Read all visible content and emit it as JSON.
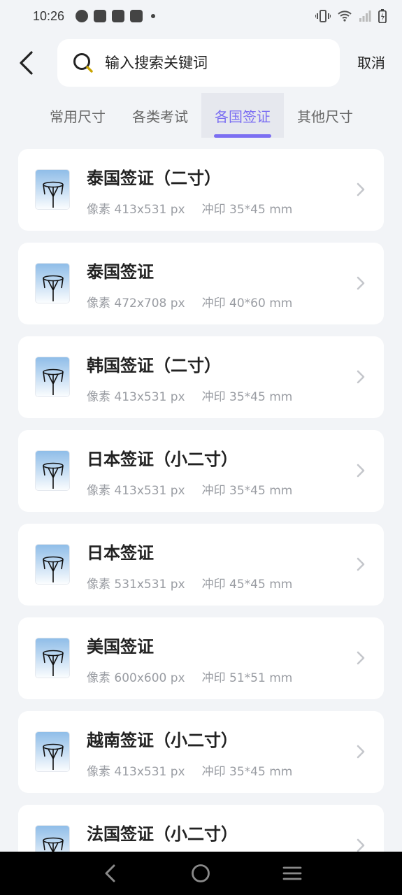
{
  "status_bar": {
    "time": "10:26"
  },
  "header": {
    "search_placeholder": "输入搜索关键词",
    "cancel_label": "取消"
  },
  "tabs": [
    {
      "label": "常用尺寸",
      "active": false
    },
    {
      "label": "各类考试",
      "active": false
    },
    {
      "label": "各国签证",
      "active": true
    },
    {
      "label": "其他尺寸",
      "active": false
    }
  ],
  "colors": {
    "accent": "#7b6ef2",
    "background": "#f2f4f7",
    "card": "#ffffff",
    "meta_text": "#9a9da3"
  },
  "items": [
    {
      "title": "泰国签证（二寸）",
      "pixels": "像素 413x531 px",
      "print": "冲印 35*45 mm",
      "icon": "umbrella-photo-icon"
    },
    {
      "title": "泰国签证",
      "pixels": "像素 472x708 px",
      "print": "冲印 40*60 mm",
      "icon": "umbrella-photo-icon"
    },
    {
      "title": "韩国签证（二寸）",
      "pixels": "像素 413x531 px",
      "print": "冲印 35*45 mm",
      "icon": "umbrella-photo-icon"
    },
    {
      "title": "日本签证（小二寸）",
      "pixels": "像素 413x531 px",
      "print": "冲印 35*45 mm",
      "icon": "umbrella-photo-icon"
    },
    {
      "title": "日本签证",
      "pixels": "像素 531x531 px",
      "print": "冲印 45*45 mm",
      "icon": "umbrella-photo-icon"
    },
    {
      "title": "美国签证",
      "pixels": "像素 600x600 px",
      "print": "冲印 51*51 mm",
      "icon": "umbrella-photo-icon"
    },
    {
      "title": "越南签证（小二寸）",
      "pixels": "像素 413x531 px",
      "print": "冲印 35*45 mm",
      "icon": "umbrella-photo-icon"
    },
    {
      "title": "法国签证（小二寸）",
      "pixels": "",
      "print": "",
      "icon": "umbrella-photo-icon"
    }
  ],
  "nav_bar": {
    "icons": [
      "back-nav-icon",
      "home-nav-icon",
      "menu-nav-icon"
    ]
  }
}
